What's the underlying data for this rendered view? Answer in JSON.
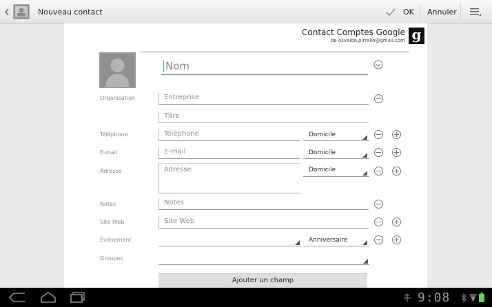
{
  "action_bar": {
    "title": "Nouveau contact",
    "ok_label": "OK",
    "cancel_label": "Annuler"
  },
  "account": {
    "title": "Contact Comptes Google",
    "email": "de osvaldo.pirrello@gmail.com",
    "logo_letter": "g"
  },
  "name": {
    "placeholder": "Nom"
  },
  "organisation": {
    "label": "Organisation",
    "company_placeholder": "Entreprise",
    "title_placeholder": "Titre"
  },
  "phone": {
    "label": "Téléphone",
    "placeholder": "Téléphone",
    "type": "Domicile"
  },
  "email": {
    "label": "E-mail",
    "placeholder": "E-mail",
    "type": "Domicile"
  },
  "address": {
    "label": "Adresse",
    "placeholder": "Adresse",
    "type": "Domicile"
  },
  "notes": {
    "label": "Notes",
    "placeholder": "Notes"
  },
  "website": {
    "label": "Site Web",
    "placeholder": "Site Web"
  },
  "event": {
    "label": "Événement",
    "type": "Anniversaire"
  },
  "groups": {
    "label": "Groupes"
  },
  "add_field_label": "Ajouter un champ",
  "system_bar": {
    "clock": "9:08"
  },
  "colors": {
    "accent_blue": "#33b5e5",
    "status_green": "#5fd35f"
  }
}
